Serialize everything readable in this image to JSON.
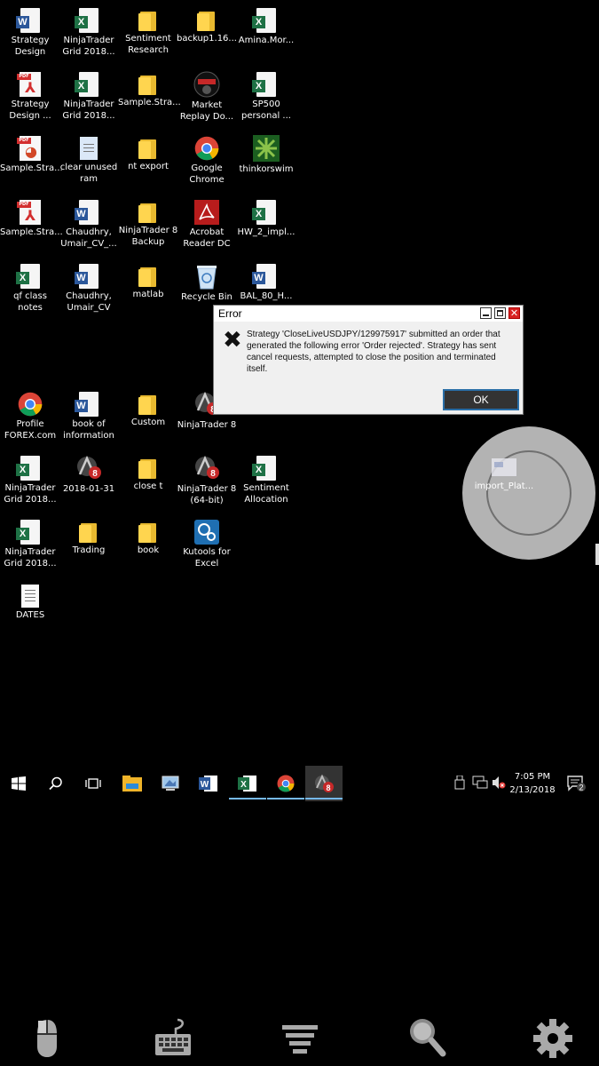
{
  "desktop": {
    "icons": [
      {
        "label": "Strategy\nDesign",
        "kind": "word"
      },
      {
        "label": "NinjaTrader\nGrid 2018...",
        "kind": "excel"
      },
      {
        "label": "Sentiment\nResearch",
        "kind": "folder"
      },
      {
        "label": "backup1.16...",
        "kind": "folder"
      },
      {
        "label": "Amina.Mor...",
        "kind": "excel"
      },
      {
        "label": "Strategy\nDesign ...",
        "kind": "pdf"
      },
      {
        "label": "NinjaTrader\nGrid 2018...",
        "kind": "excel"
      },
      {
        "label": "Sample.Stra...",
        "kind": "folder"
      },
      {
        "label": "Market\nReplay Do...",
        "kind": "replay"
      },
      {
        "label": "SP500\npersonal ...",
        "kind": "excel"
      },
      {
        "label": "Sample.Stra...",
        "kind": "pdf-ppt"
      },
      {
        "label": "clear unused\nram",
        "kind": "script"
      },
      {
        "label": "nt export",
        "kind": "folder"
      },
      {
        "label": "Google\nChrome",
        "kind": "chrome"
      },
      {
        "label": "thinkorswim",
        "kind": "tos"
      },
      {
        "label": "Sample.Stra...",
        "kind": "pdf"
      },
      {
        "label": "Chaudhry,\nUmair_CV_...",
        "kind": "word"
      },
      {
        "label": "NinjaTrader 8\nBackup",
        "kind": "folder"
      },
      {
        "label": "Acrobat\nReader DC",
        "kind": "acrobat"
      },
      {
        "label": "HW_2_impl...",
        "kind": "excel"
      },
      {
        "label": "qf class notes",
        "kind": "excel"
      },
      {
        "label": "Chaudhry,\nUmair_CV",
        "kind": "word"
      },
      {
        "label": "matlab",
        "kind": "folder"
      },
      {
        "label": "Recycle Bin",
        "kind": "recycle"
      },
      {
        "label": "BAL_80_H...",
        "kind": "word"
      },
      {
        "label": "Profile\nFOREX.com",
        "kind": "chrome"
      },
      {
        "label": "book of\ninformation",
        "kind": "word"
      },
      {
        "label": "Custom",
        "kind": "folder"
      },
      {
        "label": "NinjaTrader 8",
        "kind": "ninja"
      },
      {
        "label": "NinjaTrader\nGrid 2018...",
        "kind": "excel"
      },
      {
        "label": "2018-01-31",
        "kind": "ninja"
      },
      {
        "label": "close t",
        "kind": "folder"
      },
      {
        "label": "NinjaTrader 8\n(64-bit)",
        "kind": "ninja"
      },
      {
        "label": "Sentiment\nAllocation",
        "kind": "excel"
      },
      {
        "label": "NinjaTrader\nGrid 2018...",
        "kind": "excel"
      },
      {
        "label": "Trading",
        "kind": "folder"
      },
      {
        "label": "book",
        "kind": "folder"
      },
      {
        "label": "Kutools for\nExcel",
        "kind": "kutools"
      },
      {
        "label": "DATES",
        "kind": "text"
      }
    ]
  },
  "dialog": {
    "title": "Error",
    "message": "Strategy 'CloseLiveUSDJPY/129975917' submitted an order that generated the following error 'Order rejected'. Strategy has sent cancel requests, attempted to close the position and terminated itself.",
    "ok_label": "OK"
  },
  "floating_button": {
    "label": "import_Plat..."
  },
  "taskbar": {
    "time": "7:05 PM",
    "date": "2/13/2018",
    "notification_count": "2",
    "ninja_badge": "8"
  },
  "colors": {
    "accent": "#76b9ed",
    "excel": "#1e7145",
    "word": "#2b579a",
    "folder": "#ffd54f",
    "error_close": "#d82222"
  }
}
